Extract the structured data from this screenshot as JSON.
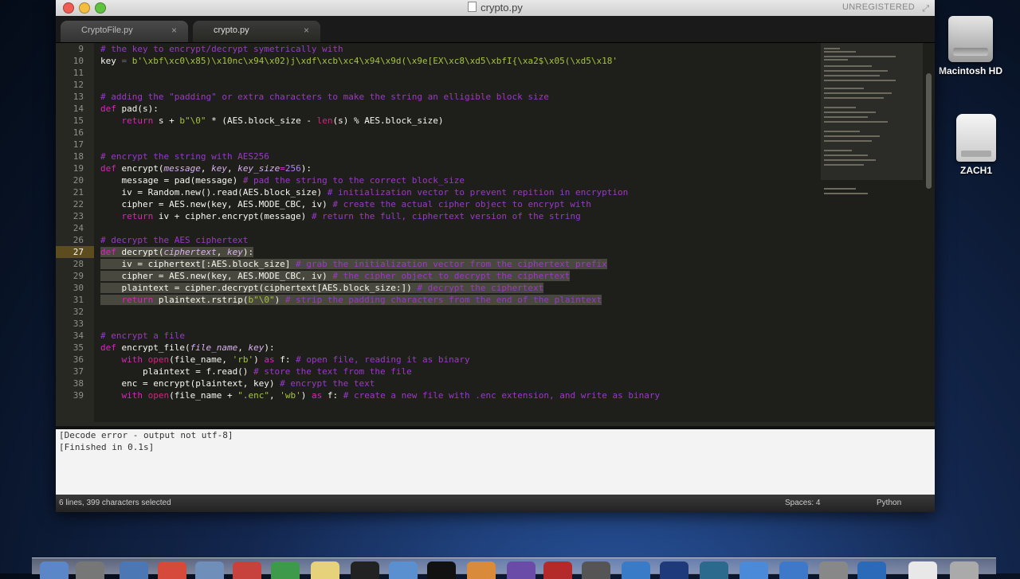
{
  "desktop": {
    "icons": [
      {
        "label": "Macintosh HD"
      },
      {
        "label": "ZACH1"
      }
    ]
  },
  "window": {
    "title": "crypto.py",
    "unregistered": "UNREGISTERED"
  },
  "tabs": [
    {
      "label": "CryptoFile.py",
      "close": "×"
    },
    {
      "label": "crypto.py",
      "close": "×"
    }
  ],
  "editor": {
    "highlighted_line": 27,
    "lines": [
      {
        "n": "9"
      },
      {
        "n": "10"
      },
      {
        "n": "11"
      },
      {
        "n": "12"
      },
      {
        "n": "13"
      },
      {
        "n": "14"
      },
      {
        "n": "15"
      },
      {
        "n": "16"
      },
      {
        "n": "17"
      },
      {
        "n": "18"
      },
      {
        "n": "19"
      },
      {
        "n": "20"
      },
      {
        "n": "21"
      },
      {
        "n": "22"
      },
      {
        "n": "23"
      },
      {
        "n": "24"
      },
      {
        "n": "26"
      },
      {
        "n": "27"
      },
      {
        "n": "28"
      },
      {
        "n": "29"
      },
      {
        "n": "30"
      },
      {
        "n": "31"
      },
      {
        "n": "32"
      },
      {
        "n": "33"
      },
      {
        "n": "34"
      },
      {
        "n": "35"
      },
      {
        "n": "36"
      },
      {
        "n": "37"
      },
      {
        "n": "38"
      },
      {
        "n": "39"
      }
    ],
    "code": {
      "l9_comment": "# the key to encrypt/decrypt symetrically with",
      "l10_key": "key",
      "l10_eq": " = ",
      "l10_str": "b'\\xbf\\xc0\\x85)\\x10nc\\x94\\x02)j\\xdf\\xcb\\xc4\\x94\\x9d(\\x9e[EX\\xc8\\xd5\\xbfI{\\xa2$\\x05(\\xd5\\x18'",
      "l13_comment": "# adding the \"padding\" or extra characters to make the string an elligible block size",
      "l14_def": "def ",
      "l14_name": "pad",
      "l14_rest": "(s):",
      "l15_indent": "    ",
      "l15_return": "return",
      "l15_a": " s + ",
      "l15_str": "b\"\\0\"",
      "l15_b": " * (AES.block_size - ",
      "l15_len": "len",
      "l15_c": "(s) % AES.block_size)",
      "l18_comment": "# encrypt the string with AES256",
      "l19_def": "def ",
      "l19_name": "encrypt",
      "l19_a": "(",
      "l19_p1": "message",
      "l19_b": ", ",
      "l19_p2": "key",
      "l19_c": ", ",
      "l19_p3": "key_size",
      "l19_d": "=",
      "l19_num": "256",
      "l19_e": "):",
      "l20_code": "    message = pad(message) ",
      "l20_comment": "# pad the string to the correct block_size",
      "l21_code": "    iv = Random.new().read(AES.block_size) ",
      "l21_comment": "# initialization vector to prevent repition in encryption",
      "l22_code": "    cipher = AES.new(key, AES.MODE_CBC, iv) ",
      "l22_comment": "# create the actual cipher object to encrypt with",
      "l23_indent": "    ",
      "l23_return": "return",
      "l23_code": " iv + cipher.encrypt(message) ",
      "l23_comment": "# return the full, ciphertext version of the string",
      "l26_comment": "# decrypt the AES ciphertext",
      "l27_def": "def ",
      "l27_name": "decrypt",
      "l27_a": "(",
      "l27_p1": "ciphertext",
      "l27_b": ", ",
      "l27_p2": "key",
      "l27_c": "):",
      "l28_code": "    iv = ciphertext[:AES.block_size]",
      "l28_comment": " # grab the initialization vector from the ciphertext prefix",
      "l29_code": "    cipher = AES.new(key, AES.MODE_CBC, iv)",
      "l29_comment": " # the cipher object to decrypt the ciphertext",
      "l30_code": "    plaintext = cipher.decrypt(ciphertext[AES.block_size:])",
      "l30_comment": " # decrypt the ciphertext",
      "l31_indent": "    ",
      "l31_return": "return",
      "l31_a": " plaintext.rstrip(",
      "l31_str": "b\"\\0\"",
      "l31_b": ")",
      "l31_comment": " # strip the padding characters from the end of the plaintext",
      "l34_comment": "# encrypt a file",
      "l35_def": "def ",
      "l35_name": "encrypt_file",
      "l35_a": "(",
      "l35_p1": "file_name",
      "l35_b": ", ",
      "l35_p2": "key",
      "l35_c": "):",
      "l36_indent": "    ",
      "l36_with": "with",
      "l36_a": " ",
      "l36_open": "open",
      "l36_b": "(file_name, ",
      "l36_str": "'rb'",
      "l36_c": ") ",
      "l36_as": "as",
      "l36_d": " f: ",
      "l36_comment": "# open file, reading it as binary",
      "l37_code": "        plaintext = f.read() ",
      "l37_comment": "# store the text from the file",
      "l38_code": "    enc = encrypt(plaintext, key) ",
      "l38_comment": "# encrypt the text",
      "l39_indent": "    ",
      "l39_with": "with",
      "l39_a": " ",
      "l39_open": "open",
      "l39_b": "(file_name + ",
      "l39_str1": "\".enc\"",
      "l39_c": ", ",
      "l39_str2": "'wb'",
      "l39_d": ") ",
      "l39_as": "as",
      "l39_e": " f: ",
      "l39_comment": "# create a new file with .enc extension, and write as binary"
    }
  },
  "console": {
    "lines": [
      "[Decode error - output not utf-8]",
      "[Finished in 0.1s]"
    ]
  },
  "statusbar": {
    "selection": "6 lines, 399 characters selected",
    "spaces": "Spaces: 4",
    "syntax": "Python"
  },
  "colors": {
    "comment": "#9a39c8",
    "keyword": "#d926ba",
    "string": "#a4c33d",
    "number": "#ae81ff",
    "editor_bg": "#1e1f1a"
  }
}
